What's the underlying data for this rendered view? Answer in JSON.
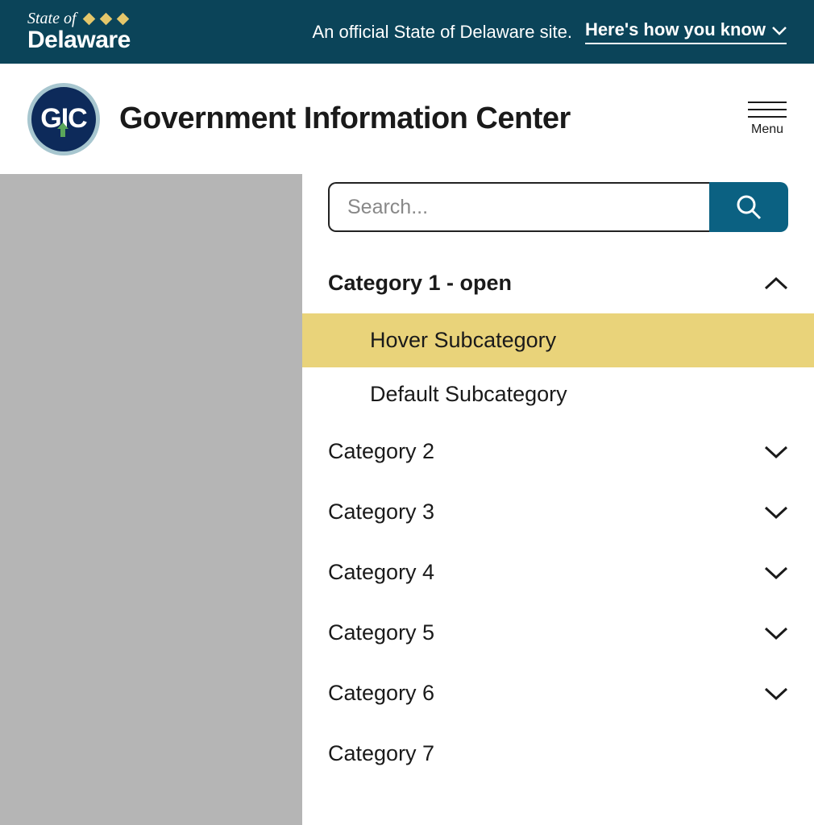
{
  "banner": {
    "state_of": "State of",
    "state_name": "Delaware",
    "official_text": "An official State of Delaware site.",
    "how_know": "Here's how you know"
  },
  "header": {
    "logo_text": "GIC",
    "site_title": "Government Information Center",
    "menu_label": "Menu"
  },
  "search": {
    "placeholder": "Search..."
  },
  "categories": [
    {
      "label": "Category 1 - open",
      "open": true
    },
    {
      "label": "Category 2",
      "open": false
    },
    {
      "label": "Category 3",
      "open": false
    },
    {
      "label": "Category 4",
      "open": false
    },
    {
      "label": "Category 5",
      "open": false
    },
    {
      "label": "Category 6",
      "open": false
    },
    {
      "label": "Category 7",
      "open": false,
      "no_chevron": true
    }
  ],
  "subcategories": [
    {
      "label": "Hover Subcategory",
      "hover": true
    },
    {
      "label": "Default Subcategory",
      "hover": false
    }
  ]
}
